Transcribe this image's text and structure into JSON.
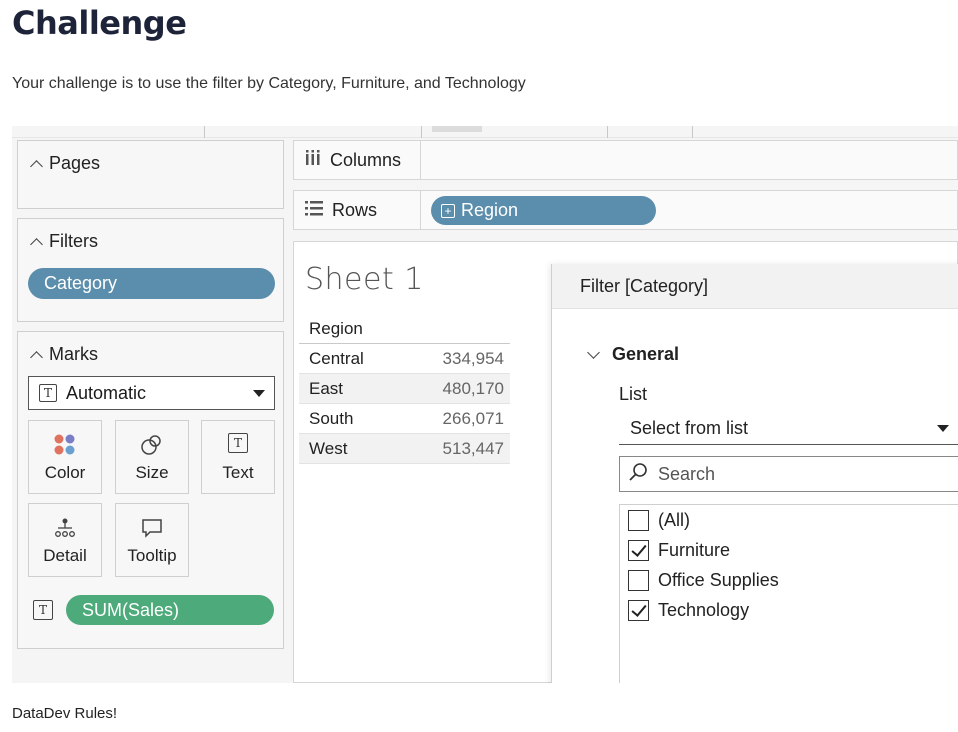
{
  "page": {
    "title": "Challenge",
    "intro": "Your challenge is to use the filter by Category, Furniture, and Technology",
    "footer": "DataDev Rules!"
  },
  "left_panel": {
    "pages_label": "Pages",
    "filters_label": "Filters",
    "filter_pill": "Category",
    "marks_label": "Marks",
    "mark_type": "Automatic",
    "mark_buttons": [
      "Color",
      "Size",
      "Text",
      "Detail",
      "Tooltip"
    ],
    "sales_pill": "SUM(Sales)"
  },
  "shelves": {
    "columns_label": "Columns",
    "rows_label": "Rows",
    "rows_pill": "Region"
  },
  "sheet": {
    "title": "Sheet 1",
    "header": "Region",
    "rows": [
      {
        "region": "Central",
        "value": "334,954"
      },
      {
        "region": "East",
        "value": "480,170"
      },
      {
        "region": "South",
        "value": "266,071"
      },
      {
        "region": "West",
        "value": "513,447"
      }
    ]
  },
  "filter_dialog": {
    "title": "Filter [Category]",
    "section": "General",
    "list_label": "List",
    "list_mode": "Select from list",
    "search_placeholder": "Search",
    "items": [
      {
        "label": "(All)",
        "checked": false
      },
      {
        "label": "Furniture",
        "checked": true
      },
      {
        "label": "Office Supplies",
        "checked": false
      },
      {
        "label": "Technology",
        "checked": true
      }
    ]
  },
  "colors": {
    "pill_blue": "#5b8eac",
    "pill_green": "#4daa7a",
    "title_navy": "#1d2338"
  }
}
